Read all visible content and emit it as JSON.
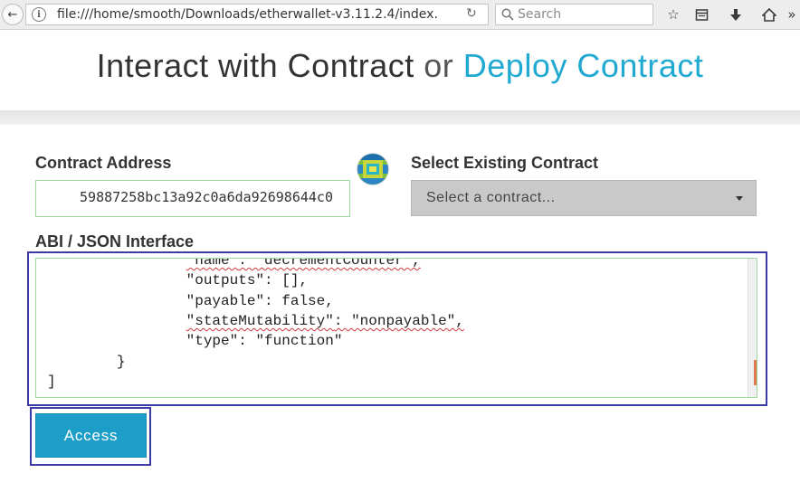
{
  "browser": {
    "url": "file:///home/smooth/Downloads/etherwallet-v3.11.2.4/index.",
    "search_placeholder": "Search"
  },
  "page": {
    "title_main": "Interact with Contract",
    "title_or": "or",
    "title_link": "Deploy Contract"
  },
  "form": {
    "contract_address_label": "Contract Address",
    "contract_address_value": "59887258bc13a92c0a6da92698644c0",
    "select_label": "Select Existing Contract",
    "select_value": "Select a contract...",
    "abi_label": "ABI / JSON Interface",
    "abi_lines": [
      {
        "indent": "                ",
        "key": "\"name\"",
        "rest": ": \"decrementCounter\",",
        "spell": true,
        "partial": true
      },
      {
        "indent": "                ",
        "key": "\"outputs\"",
        "rest": ": [],",
        "spell": false
      },
      {
        "indent": "                ",
        "key": "\"payable\"",
        "rest": ": false,",
        "spell": false
      },
      {
        "indent": "                ",
        "key": "\"stateMutability\"",
        "rest": ": \"nonpayable\",",
        "spell": true
      },
      {
        "indent": "                ",
        "key": "\"type\"",
        "rest": ": \"function\"",
        "spell": false
      },
      {
        "indent": "        ",
        "key": "}",
        "rest": "",
        "spell": false
      },
      {
        "indent": "",
        "key": "]",
        "rest": "",
        "spell": false
      }
    ],
    "access_button": "Access"
  },
  "colors": {
    "accent": "#20a9d1",
    "button": "#1d9ec9",
    "highlight_box": "#3a3aa8",
    "valid_border": "#9ed89e"
  }
}
